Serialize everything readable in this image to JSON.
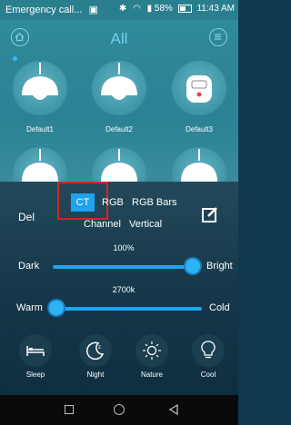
{
  "status_bar": {
    "notification": "Emergency call...",
    "battery": "58%",
    "time": "11:43 AM"
  },
  "header": {
    "title": "All"
  },
  "lights": [
    {
      "label": "Default1",
      "icon": "ceiling-lamp-icon",
      "selected": true
    },
    {
      "label": "Default2",
      "icon": "ceiling-lamp-icon",
      "selected": false
    },
    {
      "label": "Default3",
      "icon": "remote-control-icon",
      "selected": false
    }
  ],
  "panel": {
    "del_label": "Del",
    "tabs": [
      "CT",
      "RGB",
      "RGB Bars",
      "Channel",
      "Vertical"
    ],
    "active_tab": "CT",
    "brightness": {
      "value_text": "100%",
      "left_label": "Dark",
      "right_label": "Bright",
      "value": 1.0
    },
    "color_temp": {
      "value_text": "2700k",
      "left_label": "Warm",
      "right_label": "Cold",
      "value": 0.0
    },
    "modes": [
      {
        "label": "Sleep",
        "icon": "bed-icon"
      },
      {
        "label": "Night",
        "icon": "moon-icon"
      },
      {
        "label": "Nature",
        "icon": "sun-icon"
      },
      {
        "label": "Cool",
        "icon": "bulb-icon"
      }
    ]
  },
  "colors": {
    "accent": "#1fa3f0",
    "highlight": "#d82323",
    "top_bg": "#2f8a99",
    "panel_bg": "#16384a"
  }
}
